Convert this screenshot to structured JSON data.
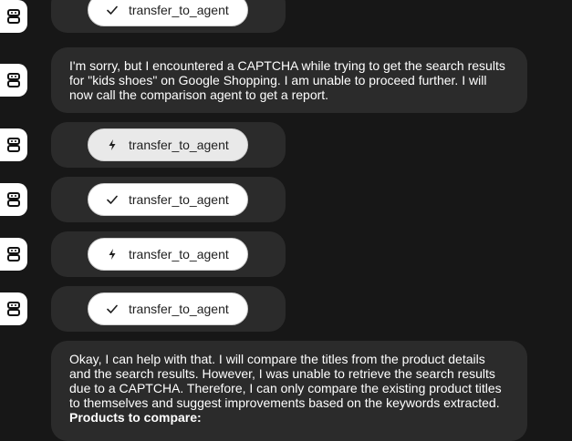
{
  "messages": [
    {
      "kind": "tool",
      "status": "done",
      "status_icon": "check-icon",
      "label": "transfer_to_agent"
    },
    {
      "kind": "text",
      "text": "I'm sorry, but I encountered a CAPTCHA while trying to get the search results for \"kids shoes\" on Google Shopping. I am unable to proceed further. I will now call the comparison agent to get a report."
    },
    {
      "kind": "tool",
      "status": "call",
      "status_icon": "bolt-icon",
      "label": "transfer_to_agent"
    },
    {
      "kind": "tool",
      "status": "done",
      "status_icon": "check-icon",
      "label": "transfer_to_agent"
    },
    {
      "kind": "tool",
      "status": "call",
      "status_icon": "bolt-icon",
      "label": "transfer_to_agent"
    },
    {
      "kind": "tool",
      "status": "done",
      "status_icon": "check-icon",
      "label": "transfer_to_agent"
    },
    {
      "kind": "text",
      "text": "Okay, I can help with that. I will compare the titles from the product details and the search results. However, I was unable to retrieve the search results due to a CAPTCHA. Therefore, I can only compare the existing product titles to themselves and suggest improvements based on the keywords extracted.",
      "heading": "Products to compare:"
    }
  ],
  "colors": {
    "background": "#171717",
    "bubble": "#2b2b2b",
    "pill": "#ffffff",
    "pill_active": "#e9e9e9",
    "text": "#ffffff"
  }
}
